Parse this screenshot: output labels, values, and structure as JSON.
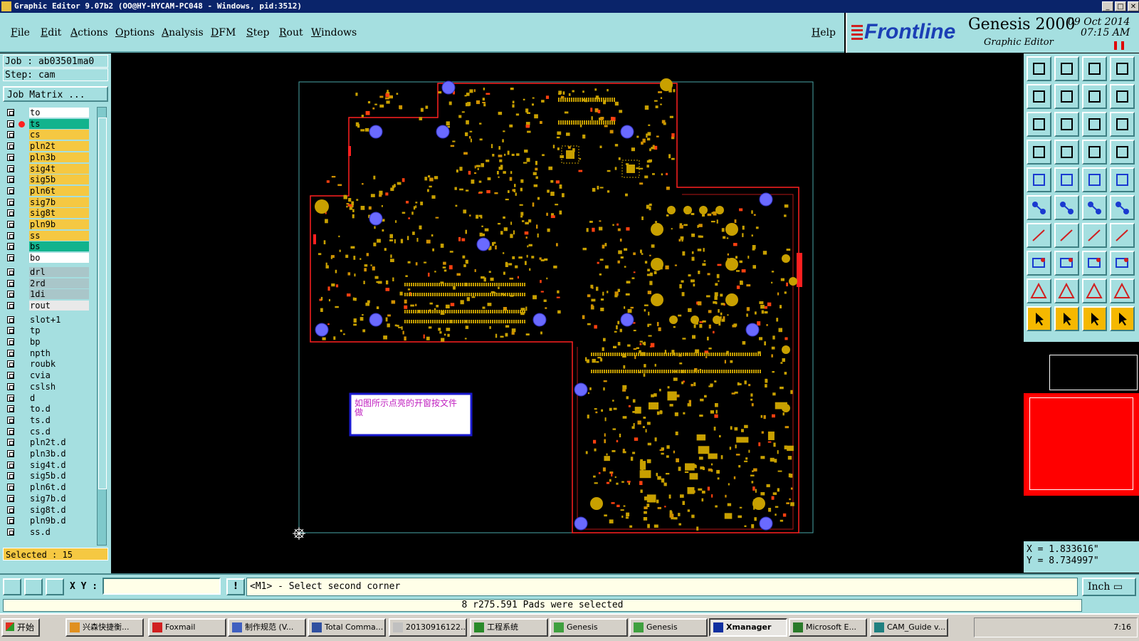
{
  "window": {
    "title": "Graphic Editor 9.07b2 (OO@HY-HYCAM-PC048 - Windows, pid:3512)"
  },
  "menu": {
    "items": [
      "File",
      "Edit",
      "Actions",
      "Options",
      "Analysis",
      "DFM",
      "Step",
      "Rout",
      "Windows"
    ],
    "help": "Help"
  },
  "brand": {
    "logo": "Frontline",
    "product": "Genesis 2000",
    "subtitle": "Graphic Editor",
    "date": "09 Oct 2014",
    "time": "07:15 AM"
  },
  "job": {
    "job_label": "Job : ab03501ma0",
    "step_label": "Step: cam",
    "matrix_button": "Job Matrix ..."
  },
  "layers": [
    {
      "name": "to",
      "color": "#ffffff"
    },
    {
      "name": "ts",
      "color": "#12b38d",
      "active": true
    },
    {
      "name": "cs",
      "color": "#f5c842"
    },
    {
      "name": "pln2t",
      "color": "#f5c842"
    },
    {
      "name": "pln3b",
      "color": "#f5c842"
    },
    {
      "name": "sig4t",
      "color": "#f5c842"
    },
    {
      "name": "sig5b",
      "color": "#f5c842"
    },
    {
      "name": "pln6t",
      "color": "#f5c842"
    },
    {
      "name": "sig7b",
      "color": "#f5c842"
    },
    {
      "name": "sig8t",
      "color": "#f5c842"
    },
    {
      "name": "pln9b",
      "color": "#f5c842"
    },
    {
      "name": "ss",
      "color": "#f5c842"
    },
    {
      "name": "bs",
      "color": "#12b38d"
    },
    {
      "name": "bo",
      "color": "#ffffff"
    },
    {
      "name": "drl",
      "color": "#a9c6c9"
    },
    {
      "name": "2rd",
      "color": "#a9c6c9"
    },
    {
      "name": "1di",
      "color": "#a9c6c9"
    },
    {
      "name": "rout",
      "color": "#e9e9e9"
    },
    {
      "name": "slot+1",
      "color": "#a5dfe0"
    },
    {
      "name": "tp",
      "color": "#a5dfe0"
    },
    {
      "name": "bp",
      "color": "#a5dfe0"
    },
    {
      "name": "npth",
      "color": "#a5dfe0"
    },
    {
      "name": "roubk",
      "color": "#a5dfe0"
    },
    {
      "name": "cvia",
      "color": "#a5dfe0"
    },
    {
      "name": "cslsh",
      "color": "#a5dfe0"
    },
    {
      "name": "d",
      "color": "#a5dfe0"
    },
    {
      "name": "to.d",
      "color": "#a5dfe0"
    },
    {
      "name": "ts.d",
      "color": "#a5dfe0"
    },
    {
      "name": "cs.d",
      "color": "#a5dfe0"
    },
    {
      "name": "pln2t.d",
      "color": "#a5dfe0"
    },
    {
      "name": "pln3b.d",
      "color": "#a5dfe0"
    },
    {
      "name": "sig4t.d",
      "color": "#a5dfe0"
    },
    {
      "name": "sig5b.d",
      "color": "#a5dfe0"
    },
    {
      "name": "pln6t.d",
      "color": "#a5dfe0"
    },
    {
      "name": "sig7b.d",
      "color": "#a5dfe0"
    },
    {
      "name": "sig8t.d",
      "color": "#a5dfe0"
    },
    {
      "name": "pln9b.d",
      "color": "#a5dfe0"
    },
    {
      "name": "ss.d",
      "color": "#a5dfe0"
    }
  ],
  "selected_label": "Selected : 15",
  "annotation": {
    "text": "如图所示点亮的开窗按文件做"
  },
  "coords": {
    "x": "X = 1.833616\"",
    "y": "Y = 8.734997\""
  },
  "command": {
    "xy_label": "X Y :",
    "xy_value": "",
    "prompt": "<M1> - Select second corner",
    "units": "Inch"
  },
  "status_message": "8 r275.591 Pads were selected",
  "taskbar": {
    "start": "开始",
    "tasks": [
      "兴森快捷衡...",
      "Foxmail",
      "制作规范 (V...",
      "Total Comma...",
      "20130916122...",
      "工程系统",
      "Genesis",
      "Genesis",
      "Xmanager",
      "Microsoft E...",
      "CAM_Guide v..."
    ],
    "clock": "7:16"
  },
  "colors": {
    "panel": "#a5dfe0",
    "outline": "#ff2020",
    "pad": "#c8a000",
    "via": "#6a6aff"
  }
}
